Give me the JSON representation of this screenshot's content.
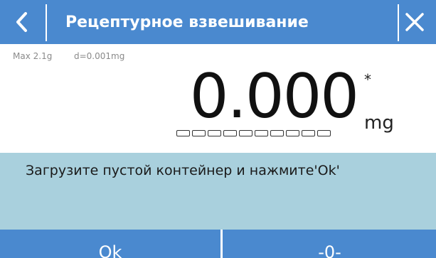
{
  "header": {
    "title": "Рецептурное взвешивание",
    "back_icon": "chevron-left-icon",
    "close_icon": "close-icon"
  },
  "specs": {
    "max": "Max 2.1g",
    "d": "d=0.001mg"
  },
  "display": {
    "weight": "0.000",
    "stable_indicator": "*",
    "unit": "mg",
    "bargraph_segments": 10,
    "bargraph_fill": 0
  },
  "message": "Загрузите пустой контейнер и нажмите'Ok'",
  "footer": {
    "ok_label": "Ok",
    "zero_label": "-0-"
  },
  "colors": {
    "header": "#4a89cf",
    "message_panel": "#a9d0dd"
  }
}
